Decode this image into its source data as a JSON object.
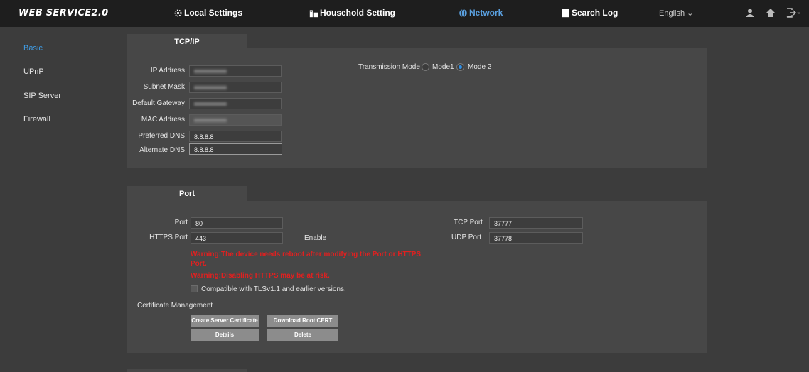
{
  "header": {
    "logo": "WEB SERVICE2.0",
    "nav": [
      {
        "label": "Local Settings"
      },
      {
        "label": "Household Setting"
      },
      {
        "label": "Network"
      },
      {
        "label": "Search Log"
      }
    ],
    "language": "English ⌄",
    "active_color": "#5aa0e0"
  },
  "sidebar": {
    "items": [
      {
        "label": "Basic"
      },
      {
        "label": "UPnP"
      },
      {
        "label": "SIP Server"
      },
      {
        "label": "Firewall"
      }
    ],
    "active_color": "#3f9de6"
  },
  "tcpip": {
    "tab_label": "TCP/IP",
    "ip_label": "IP Address",
    "ip_value": "",
    "subnet_label": "Subnet Mask",
    "subnet_value": "",
    "gateway_label": "Default Gateway",
    "gateway_value": "",
    "mac_label": "MAC Address",
    "mac_value": "",
    "dns1_label": "Preferred DNS",
    "dns1_value": "8.8.8.8",
    "dns2_label": "Alternate DNS",
    "dns2_value": "8.8.8.8",
    "mode_label": "Transmission Mode",
    "mode1_label": "Mode1",
    "mode2_label": "Mode 2",
    "selected_mode": "Mode 2"
  },
  "port": {
    "tab_label": "Port",
    "port_label": "Port",
    "port_value": "80",
    "https_label": "HTTPS Port",
    "https_value": "443",
    "enable_label": "Enable",
    "tcp_label": "TCP Port",
    "tcp_value": "37777",
    "udp_label": "UDP Port",
    "udp_value": "37778",
    "warning1_line1": "Warning:The device needs reboot after modifying the Port or HTTPS",
    "warning1_line2": "Port.",
    "warning2": "Warning:Disabling HTTPS may be at risk.",
    "tls_label": "Compatible with TLSv1.1 and earlier versions.",
    "cert_label": "Certificate Management",
    "create_cert_btn": "Create Server Certificate",
    "download_cert_btn": "Download Root CERT",
    "details_btn": "Details",
    "delete_btn": "Delete",
    "warning_color": "#e02020"
  }
}
